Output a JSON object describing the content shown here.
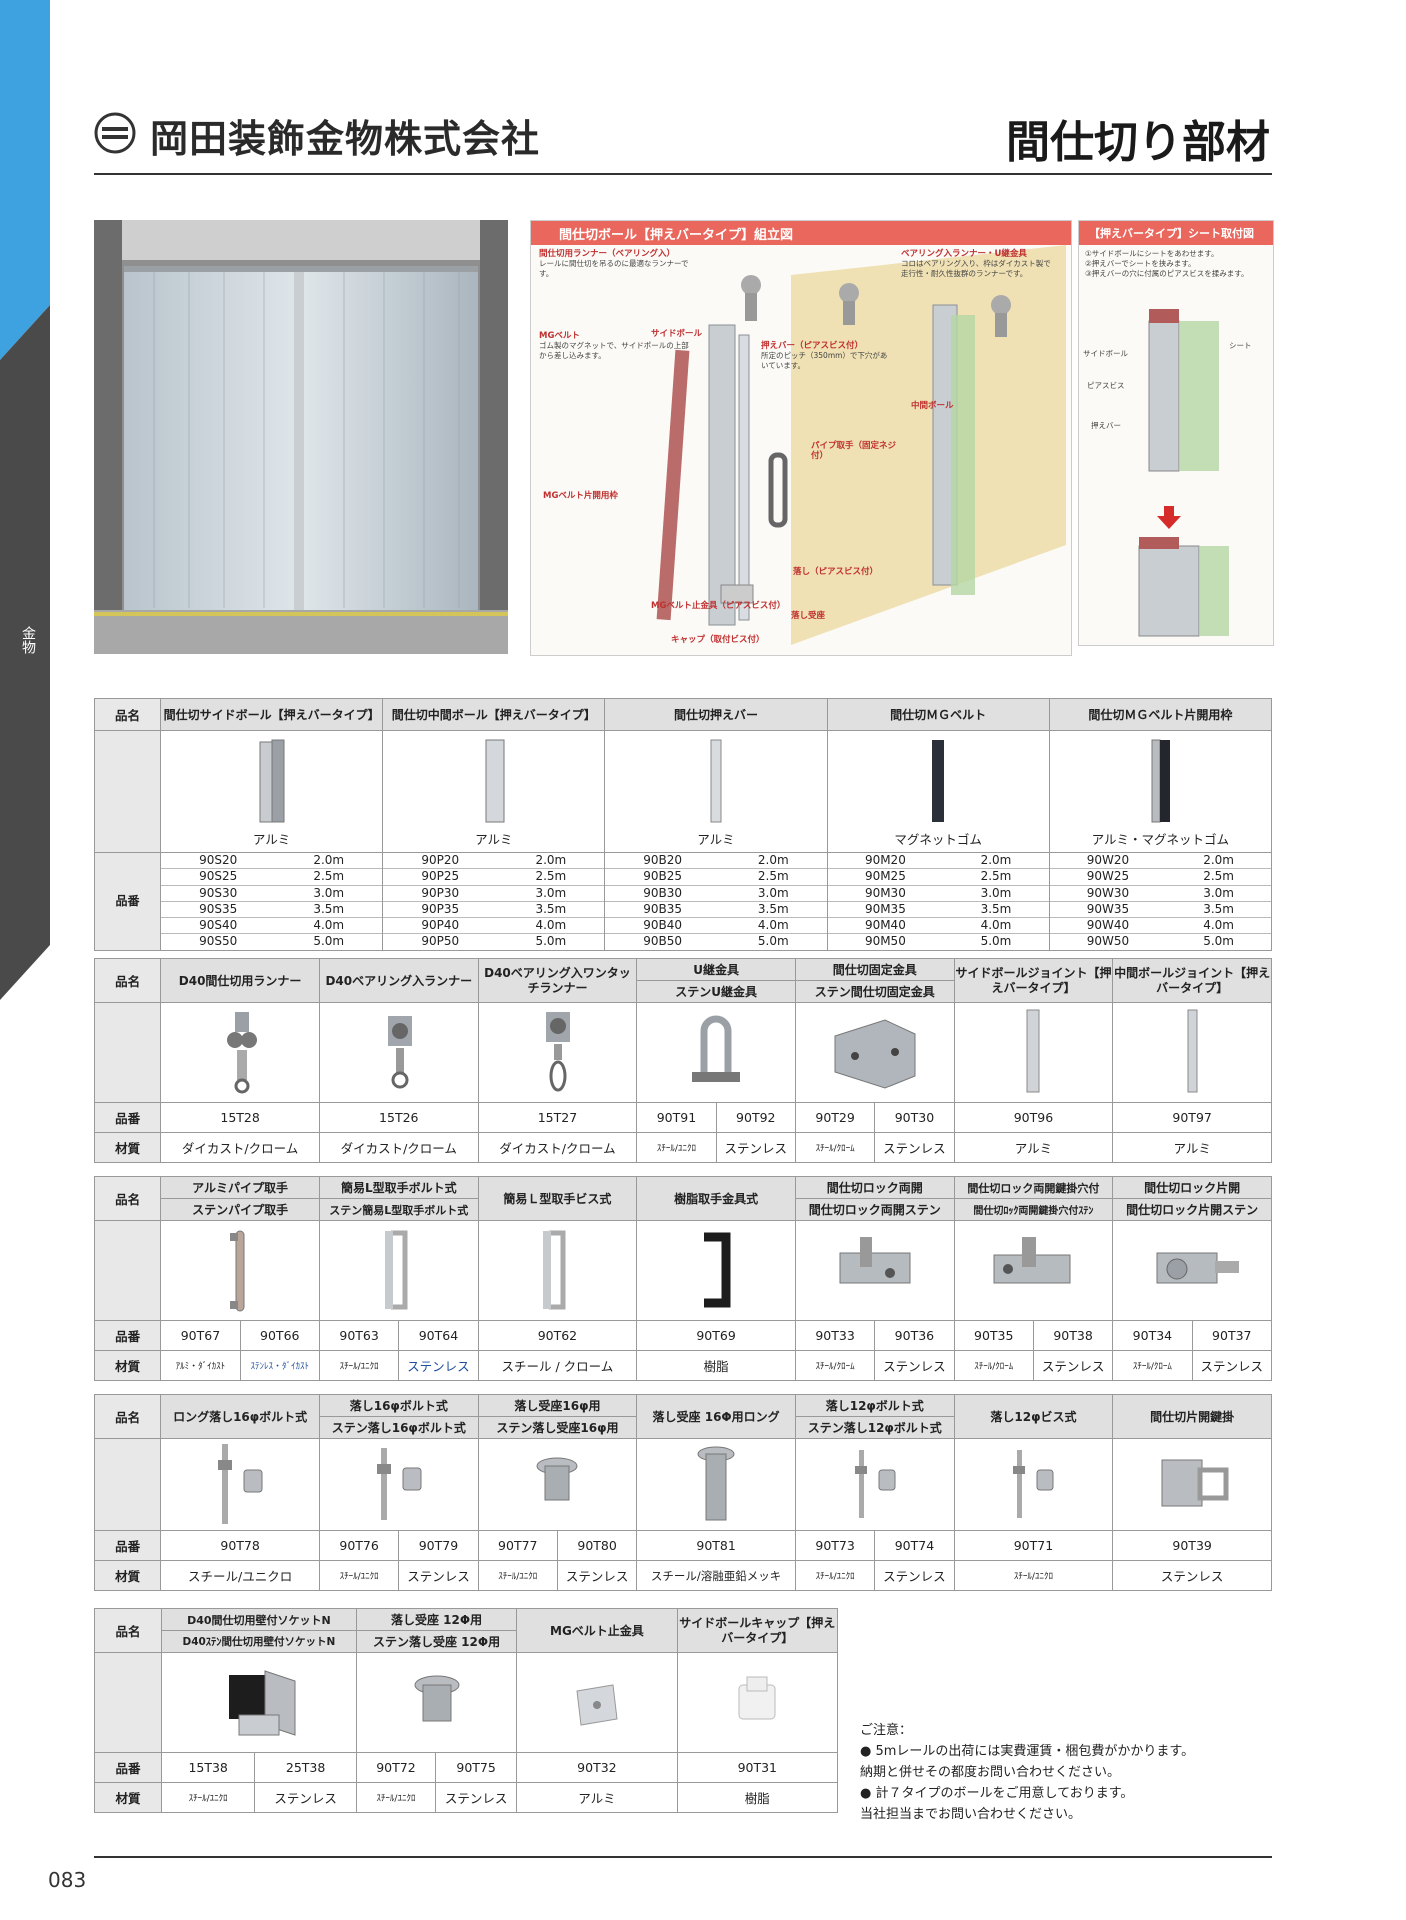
{
  "header": {
    "company": "岡田装飾金物株式会社",
    "page_title": "間仕切り部材"
  },
  "side": {
    "label": "金物"
  },
  "page_number": "083",
  "colors": {
    "accent_blue": "#3fa2e0",
    "band_gray": "#4a4a4a",
    "diagram_header": "#e9675d"
  },
  "diagram1": {
    "title": "間仕切ボール【押えバータイプ】組立図",
    "labels": {
      "runner": "間仕切用ランナー（ベアリング入）",
      "runner_text": "レールに間仕切を吊るのに最適なランナーです。",
      "mg_belt": "MGベルト",
      "mg_text": "ゴム製のマグネットで、サイドポールの上部から差し込みます。",
      "side_pole": "サイドボール",
      "press_bar": "押えバー（ピアスビス付）",
      "press_text": "所定のピッチ（350mm）で下穴があいています。",
      "pipe": "パイプ取手（固定ネジ付）",
      "bearing_u": "ベアリング入ランナー・U継金具",
      "bearing_text": "コロはベアリング入り、枠はダイカスト製で走行性・耐久性抜群のランナーです。",
      "center_pole": "中間ボール",
      "mg_frame": "MGベルト片開用枠",
      "latch": "落し（ピアスビス付）",
      "latch_seat": "落し受座",
      "stopper": "MGベルト止金具（ピアスビス付）",
      "cap": "キャップ（取付ビス付）"
    }
  },
  "diagram2": {
    "title": "【押えバータイプ】シート取付図",
    "steps": [
      "①サイドボールにシートをあわせます。",
      "②押えバーでシートを挟みます。",
      "③押えバーの穴に付属のピアスビスを揉みます。"
    ],
    "labels": {
      "side_pole": "サイドボール",
      "sheet": "シート",
      "pierce": "ピアスビス",
      "press": "押えバー"
    }
  },
  "table1": {
    "label_name": "品名",
    "label_code": "品番",
    "columns": [
      {
        "name": "間仕切サイドボール【押えバータイプ】",
        "material": "アルミ",
        "codes": [
          [
            "90S20",
            "2.0m"
          ],
          [
            "90S25",
            "2.5m"
          ],
          [
            "90S30",
            "3.0m"
          ],
          [
            "90S35",
            "3.5m"
          ],
          [
            "90S40",
            "4.0m"
          ],
          [
            "90S50",
            "5.0m"
          ]
        ]
      },
      {
        "name": "間仕切中間ボール【押えバータイプ】",
        "material": "アルミ",
        "codes": [
          [
            "90P20",
            "2.0m"
          ],
          [
            "90P25",
            "2.5m"
          ],
          [
            "90P30",
            "3.0m"
          ],
          [
            "90P35",
            "3.5m"
          ],
          [
            "90P40",
            "4.0m"
          ],
          [
            "90P50",
            "5.0m"
          ]
        ]
      },
      {
        "name": "間仕切押えバー",
        "material": "アルミ",
        "codes": [
          [
            "90B20",
            "2.0m"
          ],
          [
            "90B25",
            "2.5m"
          ],
          [
            "90B30",
            "3.0m"
          ],
          [
            "90B35",
            "3.5m"
          ],
          [
            "90B40",
            "4.0m"
          ],
          [
            "90B50",
            "5.0m"
          ]
        ]
      },
      {
        "name": "間仕切ＭＧベルト",
        "material": "マグネットゴム",
        "codes": [
          [
            "90M20",
            "2.0m"
          ],
          [
            "90M25",
            "2.5m"
          ],
          [
            "90M30",
            "3.0m"
          ],
          [
            "90M35",
            "3.5m"
          ],
          [
            "90M40",
            "4.0m"
          ],
          [
            "90M50",
            "5.0m"
          ]
        ]
      },
      {
        "name": "間仕切ＭＧベルト片開用枠",
        "material": "アルミ・マグネットゴム",
        "codes": [
          [
            "90W20",
            "2.0m"
          ],
          [
            "90W25",
            "2.5m"
          ],
          [
            "90W30",
            "3.0m"
          ],
          [
            "90W35",
            "3.5m"
          ],
          [
            "90W40",
            "4.0m"
          ],
          [
            "90W50",
            "5.0m"
          ]
        ]
      }
    ]
  },
  "table2": {
    "label_name": "品名",
    "label_code": "品番",
    "label_material": "材質",
    "h1": "D40間仕切用ランナー",
    "h2": "D40ベアリング入ランナー",
    "h3": "D40ベアリング入ワンタッチランナー",
    "h4a": "U継金具",
    "h4b": "ステンU継金具",
    "h5a": "間仕切固定金具",
    "h5b": "ステン間仕切固定金具",
    "h6": "サイドボールジョイント【押えバータイプ】",
    "h7": "中間ボールジョイント【押えバータイプ】",
    "c1": "15T28",
    "c2": "15T26",
    "c3": "15T27",
    "c4a": "90T91",
    "c4b": "90T92",
    "c5a": "90T29",
    "c5b": "90T30",
    "c6": "90T96",
    "c7": "90T97",
    "m1": "ダイカスト/クローム",
    "m2": "ダイカスト/クローム",
    "m3": "ダイカスト/クローム",
    "m4a": "ｽﾁｰﾙ/ﾕﾆｸﾛ",
    "m4b": "ステンレス",
    "m5a": "ｽﾁｰﾙ/ｸﾛｰﾑ",
    "m5b": "ステンレス",
    "m6": "アルミ",
    "m7": "アルミ"
  },
  "table3": {
    "label_name": "品名",
    "label_code": "品番",
    "label_material": "材質",
    "h1a": "アルミパイプ取手",
    "h1b": "ステンパイプ取手",
    "h2a": "簡易L型取手ボルト式",
    "h2b": "ステン簡易L型取手ボルト式",
    "h3": "簡易Ｌ型取手ビス式",
    "h4": "樹脂取手金具式",
    "h5a": "間仕切ロック両開",
    "h5b": "間仕切ロック両開ステン",
    "h6a": "間仕切ロック両開鍵掛穴付",
    "h6b": "間仕切ﾛｯｸ両開鍵掛穴付ｽﾃﾝ",
    "h7a": "間仕切ロック片開",
    "h7b": "間仕切ロック片開ステン",
    "c1a": "90T67",
    "c1b": "90T66",
    "c2a": "90T63",
    "c2b": "90T64",
    "c3": "90T62",
    "c4": "90T69",
    "c5a": "90T33",
    "c5b": "90T36",
    "c6a": "90T35",
    "c6b": "90T38",
    "c7a": "90T34",
    "c7b": "90T37",
    "m1a": "ｱﾙﾐ・ﾀﾞｲｶｽﾄ",
    "m1b": "ｽﾃﾝﾚｽ・ﾀﾞｲｶｽﾄ",
    "m2a": "ｽﾁｰﾙ/ﾕﾆｸﾛ",
    "m2b": "ステンレス",
    "m3": "スチール / クローム",
    "m4": "樹脂",
    "m5a": "ｽﾁｰﾙ/ｸﾛｰﾑ",
    "m5b": "ステンレス",
    "m6a": "ｽﾁｰﾙ/ｸﾛｰﾑ",
    "m6b": "ステンレス",
    "m7a": "ｽﾁｰﾙ/ｸﾛｰﾑ",
    "m7b": "ステンレス"
  },
  "table4": {
    "label_name": "品名",
    "label_code": "品番",
    "label_material": "材質",
    "h1": "ロング落し16φボルト式",
    "h2a": "落し16φボルト式",
    "h2b": "ステン落し16φボルト式",
    "h3a": "落し受座16φ用",
    "h3b": "ステン落し受座16φ用",
    "h4": "落し受座 16Φ用ロング",
    "h5a": "落し12φボルト式",
    "h5b": "ステン落し12φボルト式",
    "h6": "落し12φビス式",
    "h7": "間仕切片開鍵掛",
    "c1": "90T78",
    "c2a": "90T76",
    "c2b": "90T79",
    "c3a": "90T77",
    "c3b": "90T80",
    "c4": "90T81",
    "c5a": "90T73",
    "c5b": "90T74",
    "c6": "90T71",
    "c7": "90T39",
    "m1": "スチール/ユニクロ",
    "m2a": "ｽﾁｰﾙ/ﾕﾆｸﾛ",
    "m2b": "ステンレス",
    "m3a": "ｽﾁｰﾙ/ﾕﾆｸﾛ",
    "m3b": "ステンレス",
    "m4": "スチール/溶融亜鉛メッキ",
    "m5a": "ｽﾁｰﾙ/ﾕﾆｸﾛ",
    "m5b": "ステンレス",
    "m6": "ｽﾁｰﾙ/ﾕﾆｸﾛ",
    "m7": "ステンレス"
  },
  "table5": {
    "label_name": "品名",
    "label_code": "品番",
    "label_material": "材質",
    "h1a": "D40間仕切用壁付ソケットN",
    "h1b": "D40ｽﾃﾝ間仕切用壁付ソケットN",
    "h2a": "落し受座 12Φ用",
    "h2b": "ステン落し受座 12Φ用",
    "h3": "MGベルト止金具",
    "h4": "サイドボールキャップ【押えバータイプ】",
    "c1a": "15T38",
    "c1b": "25T38",
    "c2a": "90T72",
    "c2b": "90T75",
    "c3": "90T32",
    "c4": "90T31",
    "m1a": "ｽﾁｰﾙ/ﾕﾆｸﾛ",
    "m1b": "ステンレス",
    "m2a": "ｽﾁｰﾙ/ﾕﾆｸﾛ",
    "m2b": "ステンレス",
    "m3": "アルミ",
    "m4": "樹脂"
  },
  "notes": {
    "title": "ご注意：",
    "lines": [
      "● 5mレールの出荷には実費運賃・梱包費がかかります。",
      "納期と併せその都度お問い合わせください。",
      "● 計７タイプのボールをご用意しております。",
      "当社担当までお問い合わせください。"
    ]
  }
}
